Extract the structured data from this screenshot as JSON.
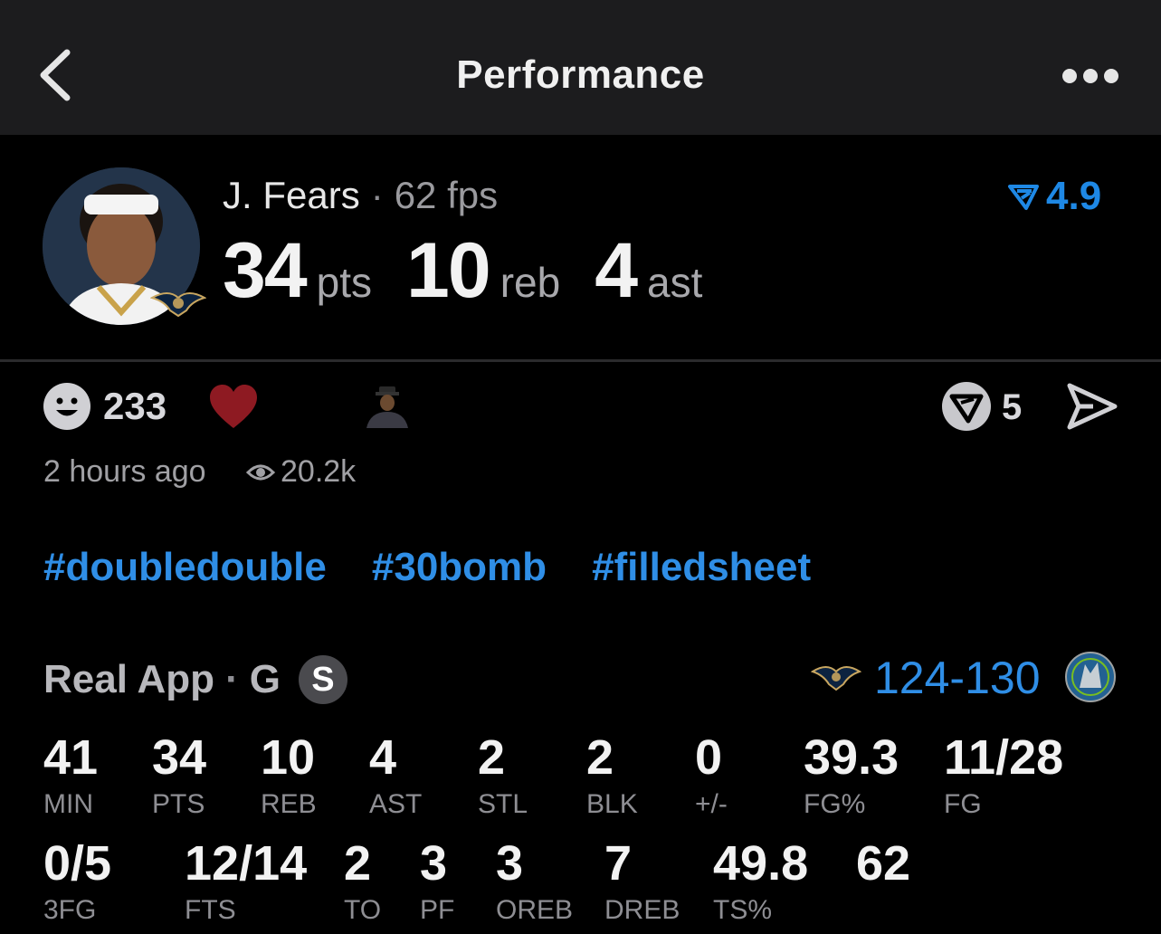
{
  "nav": {
    "title": "Performance"
  },
  "player": {
    "name": "J. Fears",
    "separator": "·",
    "fps": "62 fps",
    "rating": "4.9",
    "headline": [
      {
        "value": "34",
        "unit": "pts"
      },
      {
        "value": "10",
        "unit": "reb"
      },
      {
        "value": "4",
        "unit": "ast"
      }
    ]
  },
  "reactions": {
    "count": "233",
    "v_count": "5",
    "time": "2 hours ago",
    "views": "20.2k"
  },
  "hashtags": [
    "#doubledouble",
    "#30bomb",
    "#filledsheet"
  ],
  "game": {
    "source": "Real App",
    "separator": "·",
    "position": "G",
    "badge": "S",
    "score": "124-130"
  },
  "stats_row1": [
    {
      "value": "41",
      "label": "MIN"
    },
    {
      "value": "34",
      "label": "PTS"
    },
    {
      "value": "10",
      "label": "REB"
    },
    {
      "value": "4",
      "label": "AST"
    },
    {
      "value": "2",
      "label": "STL"
    },
    {
      "value": "2",
      "label": "BLK"
    },
    {
      "value": "0",
      "label": "+/-"
    },
    {
      "value": "39.3",
      "label": "FG%"
    },
    {
      "value": "11/28",
      "label": "FG"
    }
  ],
  "stats_row2": [
    {
      "value": "0/5",
      "label": "3FG"
    },
    {
      "value": "12/14",
      "label": "FTS"
    },
    {
      "value": "2",
      "label": "TO"
    },
    {
      "value": "3",
      "label": "PF"
    },
    {
      "value": "3",
      "label": "OREB"
    },
    {
      "value": "7",
      "label": "DREB"
    },
    {
      "value": "49.8",
      "label": "TS%"
    },
    {
      "value": "62",
      "label": ""
    }
  ],
  "colors": {
    "accent": "#2f8ee6",
    "heart": "#8e1a22",
    "nav_bg": "#1c1c1e"
  }
}
